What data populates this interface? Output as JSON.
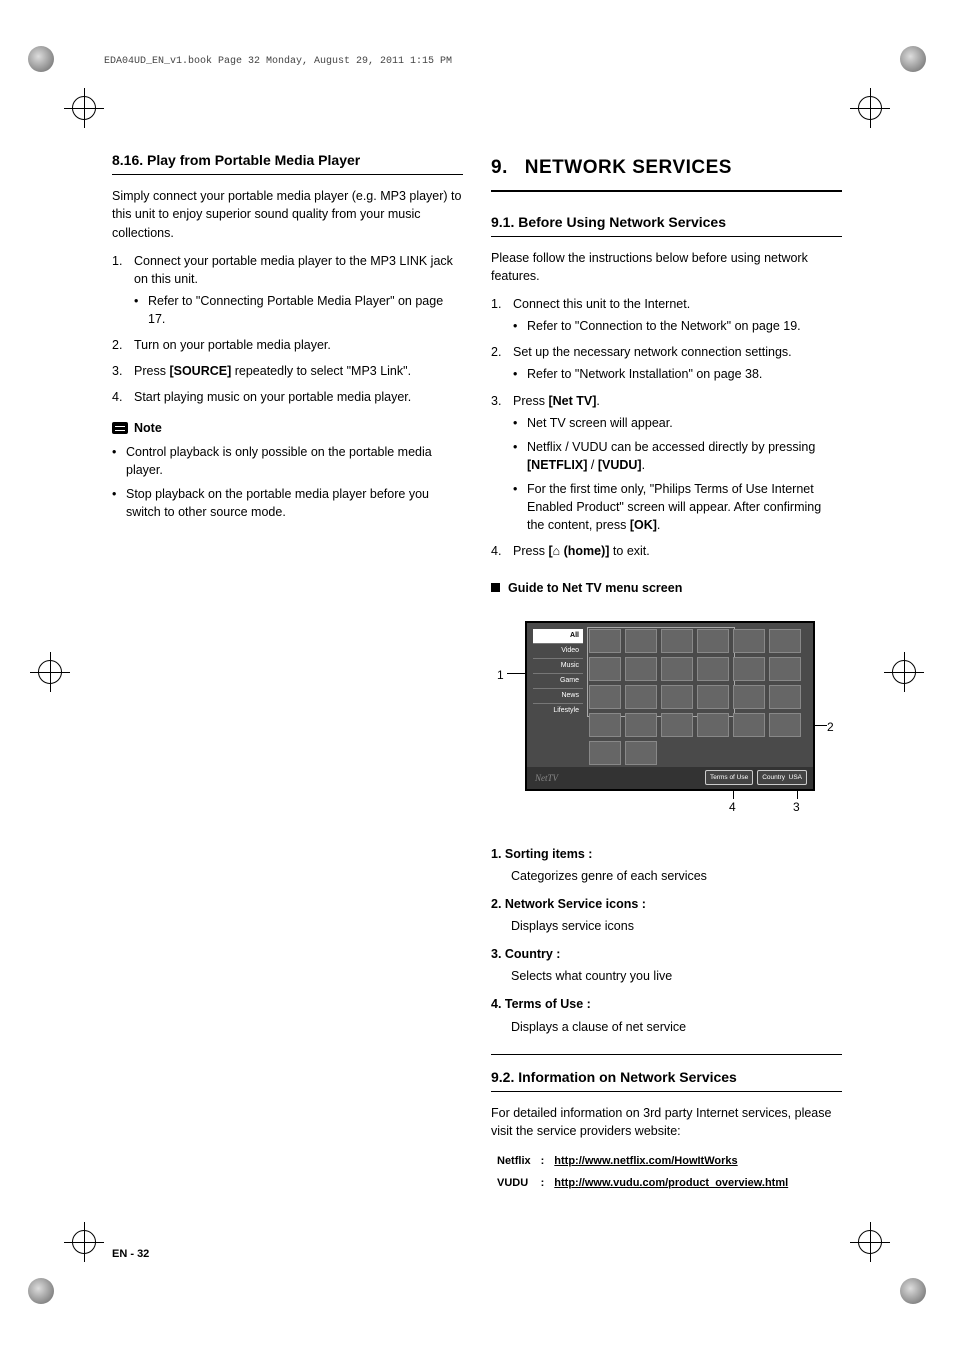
{
  "crop_header": "EDA04UD_EN_v1.book  Page 32  Monday, August 29, 2011  1:15 PM",
  "left": {
    "section_title": "8.16.  Play from Portable Media Player",
    "intro": "Simply connect your portable media player (e.g. MP3 player) to this unit to enjoy superior sound quality from your music collections.",
    "steps": [
      {
        "n": "1.",
        "text": "Connect your portable media player to the MP3 LINK jack on this unit.",
        "sub": [
          "Refer to \"Connecting Portable Media Player\" on page 17."
        ]
      },
      {
        "n": "2.",
        "text": "Turn on your portable media player."
      },
      {
        "n": "3.",
        "text_pre": "Press ",
        "bold": "[SOURCE]",
        "text_post": " repeatedly to select \"MP3 Link\"."
      },
      {
        "n": "4.",
        "text": "Start playing music on your portable media player."
      }
    ],
    "note_label": "Note",
    "notes": [
      "Control playback is only possible on the portable media player.",
      "Stop playback on the portable media player before you switch to other source mode."
    ]
  },
  "right": {
    "chapter_num": "9.",
    "chapter_title": "NETWORK SERVICES",
    "s91_title": "9.1.   Before Using Network Services",
    "s91_intro": "Please follow the instructions below before using network features.",
    "s91_steps": [
      {
        "n": "1.",
        "text": "Connect this unit to the Internet.",
        "sub": [
          "Refer to \"Connection to the Network\" on page 19."
        ]
      },
      {
        "n": "2.",
        "text": "Set up the necessary network connection settings.",
        "sub": [
          "Refer to \"Network Installation\" on page 38."
        ]
      },
      {
        "n": "3.",
        "text_pre": "Press ",
        "bold": "[Net TV]",
        "text_post": ".",
        "sub_rich": [
          {
            "plain": "Net TV screen will appear."
          },
          {
            "pre": "Netflix / VUDU can be accessed directly by pressing ",
            "b1": "[NETFLIX]",
            "mid": " / ",
            "b2": "[VUDU]",
            "post": "."
          },
          {
            "pre": "For the first time only, \"Philips Terms of Use Internet Enabled Product\" screen will appear. After confirming the content, press ",
            "b1": "[OK]",
            "post": "."
          }
        ]
      },
      {
        "n": "4.",
        "text_pre": "Press ",
        "bold": "[⌂ (home)]",
        "text_post": " to exit."
      }
    ],
    "guide_title": "Guide to Net TV menu screen",
    "screen": {
      "sidebar": [
        "All",
        "Video",
        "Music",
        "Game",
        "News",
        "Lifestyle"
      ],
      "logo": "NetTV",
      "footer_terms": "Terms of Use",
      "footer_country_lbl": "Country",
      "footer_country_val": "USA"
    },
    "callouts": {
      "c1": "1",
      "c2": "2",
      "c3": "3",
      "c4": "4"
    },
    "defs": [
      {
        "term": "1.   Sorting items :",
        "def": "Categorizes genre of each services"
      },
      {
        "term": "2.   Network Service icons :",
        "def": "Displays service icons"
      },
      {
        "term": "3.   Country :",
        "def": "Selects what country you live"
      },
      {
        "term": "4.   Terms of Use :",
        "def": "Displays a clause of net service"
      }
    ],
    "s92_title": "9.2.   Information on Network Services",
    "s92_intro": "For detailed information on 3rd party Internet services, please visit the service providers website:",
    "links": [
      {
        "name": "Netflix",
        "sep": ":",
        "url": "http://www.netflix.com/HowItWorks"
      },
      {
        "name": "VUDU",
        "sep": ":",
        "url": "http://www.vudu.com/product_overview.html"
      }
    ]
  },
  "footer": {
    "lang": "EN",
    "sep": " - ",
    "page": "32"
  }
}
